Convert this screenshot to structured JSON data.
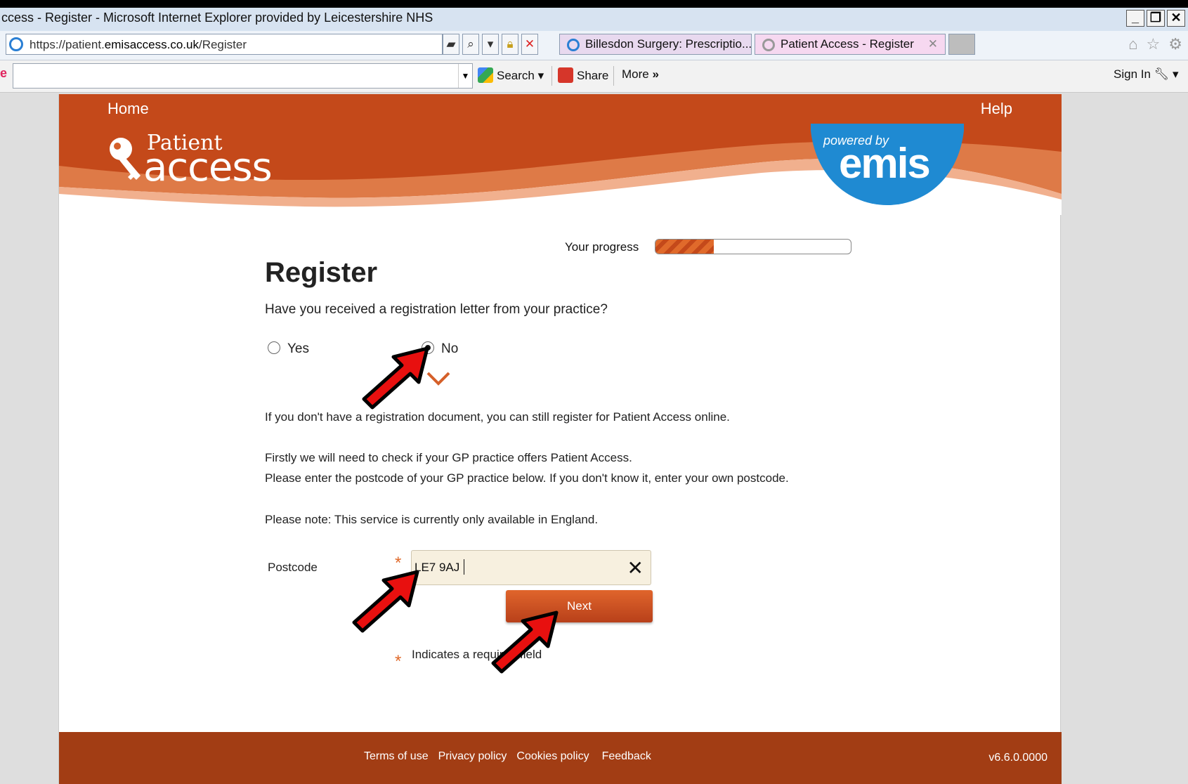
{
  "browser": {
    "title": "ccess  - Register - Microsoft Internet Explorer provided by Leicestershire NHS",
    "window_buttons": [
      "_",
      "❐",
      "✕"
    ],
    "address_prefix": "https://patient.",
    "address_domain": "emisaccess.co.uk",
    "address_path": "/Register",
    "tabs": [
      {
        "label": "Billesdon Surgery: Prescriptio..."
      },
      {
        "label": "Patient Access  - Register",
        "close": "✕"
      }
    ],
    "toolbar": {
      "brandmark": "e",
      "search_label": "Search",
      "share_label": "Share",
      "more_label": "More",
      "sign_in_label": "Sign In"
    }
  },
  "site": {
    "nav_home": "Home",
    "nav_help": "Help",
    "logo_top": "Patient",
    "logo_bottom": "access",
    "powered_by": "powered by",
    "emis": "emis",
    "accent_color": "#c4491a"
  },
  "form": {
    "progress_label": "Your progress",
    "progress_fraction": 0.3,
    "title": "Register",
    "question": "Have you received a registration letter from your practice?",
    "options": [
      {
        "label": "Yes",
        "selected": false
      },
      {
        "label": "No",
        "selected": true
      }
    ],
    "info_1": "If you don't have a registration document, you can still register for Patient Access online.",
    "info_2": "Firstly we will need to check if your GP practice offers Patient Access.",
    "info_3": "Please enter the postcode of your GP practice below. If you don't know it, enter your own postcode.",
    "info_4": "Please note: This service is currently only available in England.",
    "postcode_label": "Postcode",
    "postcode_value": "LE7 9AJ",
    "required_marker": "*",
    "next_label": "Next",
    "required_note": "Indicates a required field"
  },
  "footer": {
    "links": [
      "Terms of use",
      "Privacy policy",
      "Cookies policy",
      "Feedback"
    ],
    "version": "v6.6.0.0000"
  }
}
